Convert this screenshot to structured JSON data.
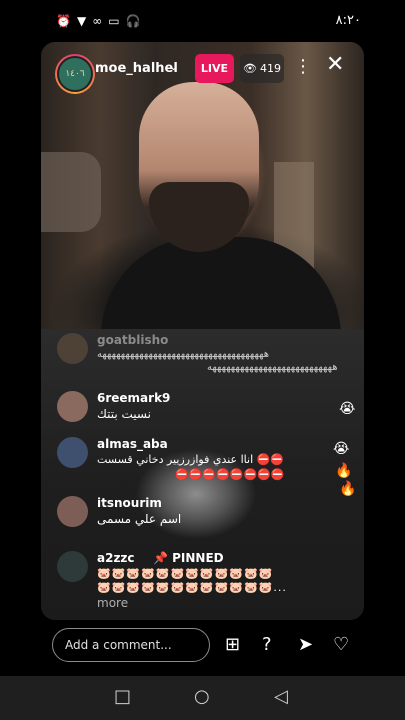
{
  "status_bar": {
    "time": "٨:٢٠",
    "icons": [
      "alarm-icon",
      "wifi-icon",
      "link-icon",
      "cast-icon",
      "headset-icon"
    ]
  },
  "live": {
    "host_username": "moe_halhel",
    "live_label": "LIVE",
    "viewer_count": "419",
    "avatar_text": "١٤٠٦"
  },
  "comments": [
    {
      "username": "goatblisho",
      "text_line1": "ههههههههههههههههههههههههههههههههههههه",
      "text_line2": "هههههههههههههههههههههههههههه"
    },
    {
      "username": "6reemark9",
      "text_line1": "نسيت بتتك"
    },
    {
      "username": "almas_aba",
      "text_line1": "اناا عندي فوازرزيير دخاني قسست ⛔⛔",
      "text_line2": "⛔⛔⛔⛔⛔⛔⛔⛔"
    },
    {
      "username": "itsnourim",
      "text_line1": "اسم علي مسمى"
    },
    {
      "username": "a2zzc",
      "pinned_label": "📌 PINNED",
      "emoji_line1": "🐷🐷🐷🐷🐷🐷🐷🐷🐷🐷🐷🐷",
      "emoji_line2": "🐷🐷🐷🐷🐷🐷🐷🐷🐷🐷🐷🐷...",
      "more_label": "more"
    }
  ],
  "reactions": [
    "😭",
    "😭",
    "🔥",
    "🔥"
  ],
  "footer": {
    "comment_placeholder": "Add a comment..."
  },
  "colors": {
    "live_badge": "#e8185c",
    "background": "#000000"
  }
}
